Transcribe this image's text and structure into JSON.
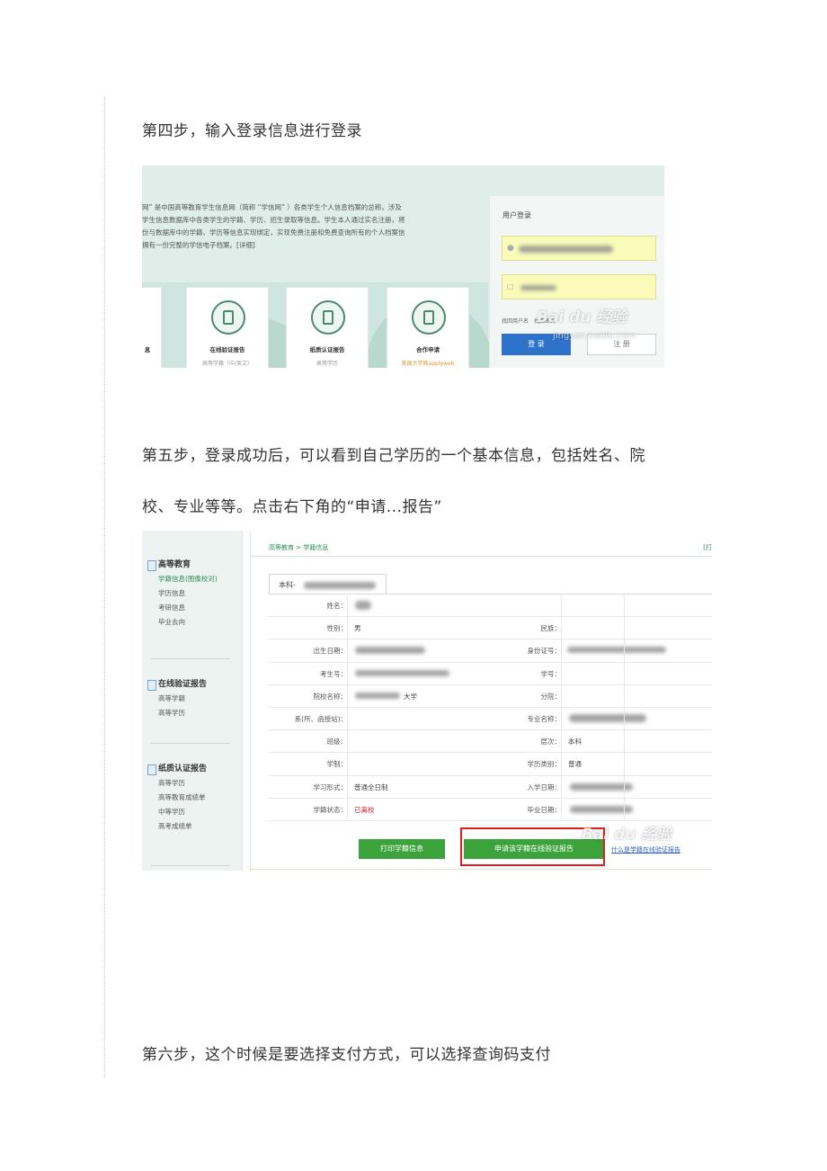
{
  "steps": {
    "step4": "第四步，输入登录信息进行登录",
    "step5_line1": "第五步，登录成功后，可以看到自己学历的一个基本信息，包括姓名、院",
    "step5_line2": "校、专业等等。点击右下角的“申请...报告”",
    "step6": "第六步，这个时候是要选择支付方式，可以选择查询码支付"
  },
  "shot1": {
    "intro_lines": [
      "网” 是中国高等教育学生信息网（简称 “学信网” ）各类学生个人信息档案的总称，涉及",
      "学生信息数据库中各类学生的学籍、学历、招生录取等信息。学生本人通过实名注册，将",
      "份与数据库中的学籍、学历等信息实现绑定，实现免费注册和免费查询所有的个人档案信",
      "拥有一份完整的学信电子档案。[详细]"
    ],
    "cards": [
      {
        "title": "息",
        "sub": ""
      },
      {
        "title": "在线验证报告",
        "sub": "高等学籍（中/英文）"
      },
      {
        "title": "纸质认证报告",
        "sub": "高等学历"
      },
      {
        "title": "合作申请",
        "sub": "美国大学网applyweb"
      }
    ],
    "login_title": "用户登录",
    "links": "找回用户名　找回密码",
    "login_btn": "登 录",
    "register_btn": "注 册",
    "watermark": "Bai du 经验",
    "watermark_sub": "jingyan.baidu.com"
  },
  "shot2": {
    "sidebar": [
      {
        "head": "高等教育",
        "items": [
          "学籍信息(图像校对)",
          "学历信息",
          "考研信息",
          "毕业去向"
        ],
        "active": 0
      },
      {
        "head": "在线验证报告",
        "items": [
          "高等学籍",
          "高等学历"
        ]
      },
      {
        "head": "纸质认证报告",
        "items": [
          "高等学历",
          "高等教育成绩单",
          "中等学历",
          "高考成绩单"
        ]
      }
    ],
    "breadcrumb": "高等教育 > 学籍信息",
    "breadcrumb_right": "[打",
    "tab": "本科-",
    "rows": [
      {
        "l1": "姓名：",
        "v1": "",
        "l2": "",
        "v2": ""
      },
      {
        "l1": "性别：",
        "v1": "男",
        "l2": "民族：",
        "v2": ""
      },
      {
        "l1": "出生日期：",
        "v1": "",
        "l2": "身份证号：",
        "v2": ""
      },
      {
        "l1": "考生号：",
        "v1": "",
        "l2": "学号：",
        "v2": ""
      },
      {
        "l1": "院校名称：",
        "v1": "大学",
        "l2": "分院：",
        "v2": ""
      },
      {
        "l1": "系(所、函授站)：",
        "v1": "",
        "l2": "专业名称：",
        "v2": ""
      },
      {
        "l1": "班级：",
        "v1": "",
        "l2": "层次：",
        "v2": "本科"
      },
      {
        "l1": "学制：",
        "v1": "",
        "l2": "学历类别：",
        "v2": "普通"
      },
      {
        "l1": "学习形式：",
        "v1": "普通全日制",
        "l2": "入学日期：",
        "v2": ""
      },
      {
        "l1": "学籍状态：",
        "v1": "已离校",
        "l2": "毕业日期：",
        "v2": ""
      }
    ],
    "print_btn": "打印学籍信息",
    "apply_btn": "申请该学籍在线验证报告",
    "help_link": "什么是学籍在线验证报告",
    "colors": {
      "green": "#3ca33c",
      "highlight": "#e02020",
      "link": "#2a5fc5"
    }
  }
}
